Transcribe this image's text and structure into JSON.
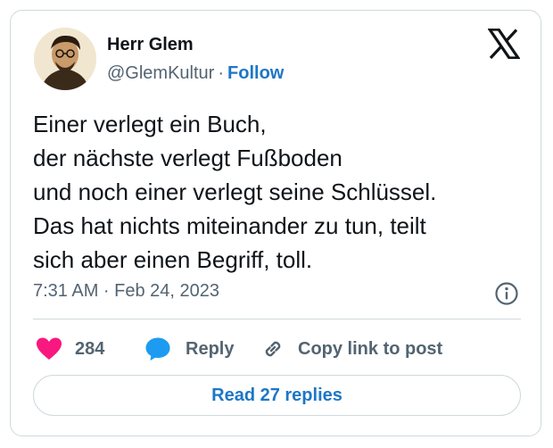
{
  "author": {
    "display_name": "Herr Glem",
    "handle": "@GlemKultur",
    "separator": "·",
    "follow_label": "Follow"
  },
  "tweet": {
    "lines": [
      "Einer verlegt ein Buch,",
      "der nächste verlegt Fußboden",
      "und noch einer verlegt seine Schlüssel.",
      "Das hat nichts miteinander zu tun, teilt",
      "sich aber einen Begriff, toll."
    ],
    "timestamp": "7:31 AM · Feb 24, 2023"
  },
  "actions": {
    "like_count": "284",
    "reply_label": "Reply",
    "copy_label": "Copy link to post"
  },
  "read_replies_label": "Read 27 replies",
  "icons": {
    "logo": "x-logo-icon",
    "info": "info-icon",
    "like": "heart-icon",
    "reply": "speech-bubble-icon",
    "copy": "link-icon"
  },
  "colors": {
    "accent": "#1d77c6",
    "heart": "#f91880",
    "reply_bubble": "#1d9bf0",
    "text": "#0f1419",
    "muted": "#536471",
    "border": "#cfd9de"
  }
}
